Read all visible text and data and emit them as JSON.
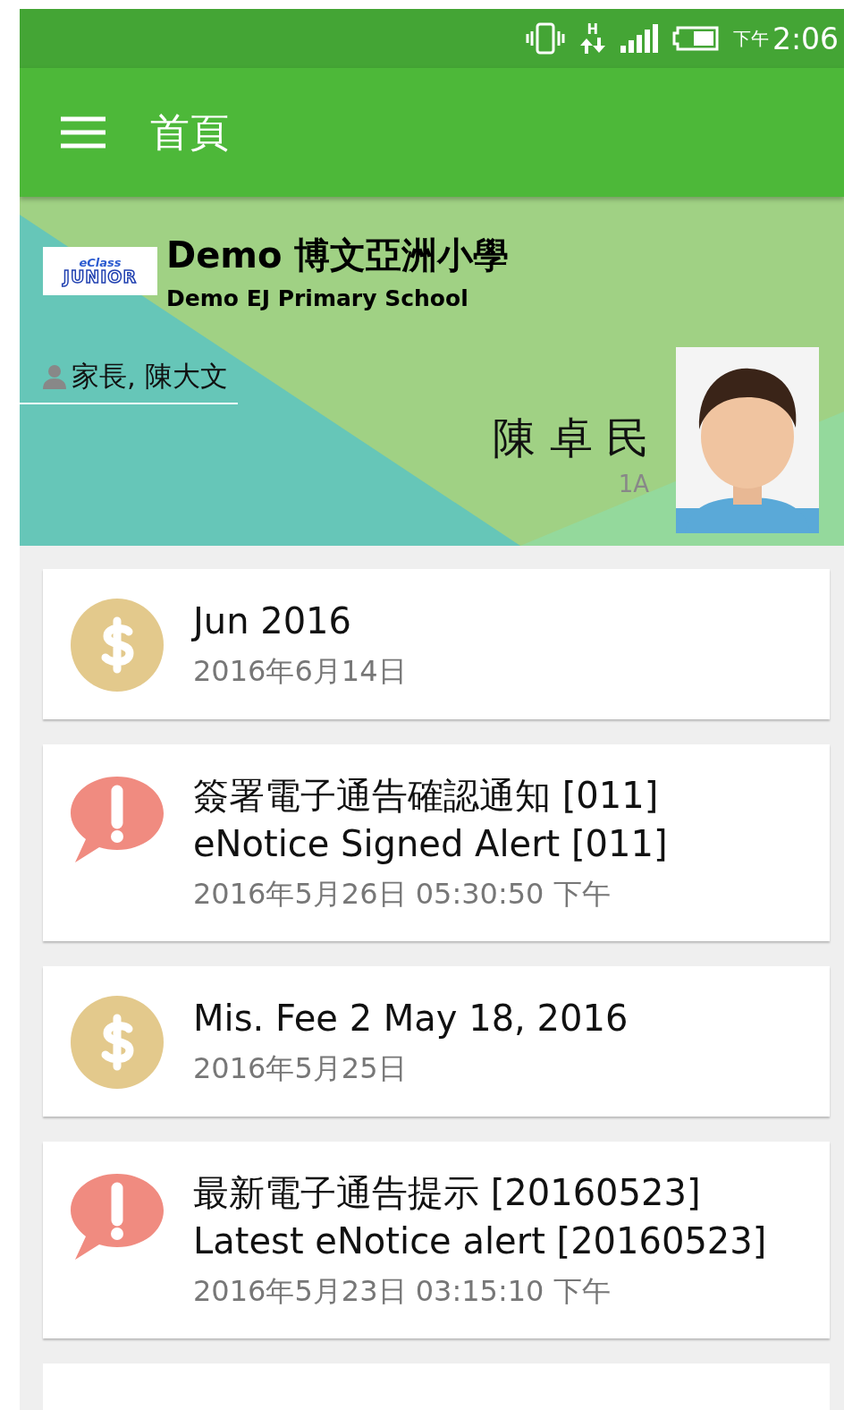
{
  "status_bar": {
    "network_type": "H",
    "period": "下午",
    "time": "2:06"
  },
  "toolbar": {
    "title": "首頁"
  },
  "school": {
    "logo_top": "eClass",
    "logo_bottom": "JUNIOR",
    "name": "Demo 博文亞洲小學",
    "name_en": "Demo EJ Primary School"
  },
  "user": {
    "label": "家長, 陳大文"
  },
  "student": {
    "name": "陳 卓 民",
    "class": "1A"
  },
  "feed": [
    {
      "kind": "fee",
      "lines": [
        "Jun 2016"
      ],
      "date": "2016年6月14日"
    },
    {
      "kind": "notice",
      "lines": [
        "簽署電子通告確認通知 [011]",
        "eNotice Signed Alert [011]"
      ],
      "date": "2016年5月26日 05:30:50 下午"
    },
    {
      "kind": "fee",
      "lines": [
        "Mis. Fee 2 May 18, 2016"
      ],
      "date": "2016年5月25日"
    },
    {
      "kind": "notice",
      "lines": [
        "最新電子通告提示 [20160523]",
        "Latest eNotice alert [20160523]"
      ],
      "date": "2016年5月23日 03:15:10 下午"
    }
  ]
}
